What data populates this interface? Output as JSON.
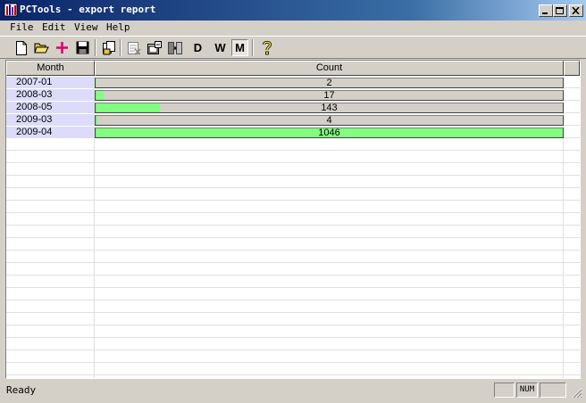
{
  "window": {
    "title": "PCTools - export report",
    "icons": {
      "app": "app-icon",
      "minimize": "minimize-icon",
      "maximize": "maximize-icon",
      "close": "close-icon"
    }
  },
  "menu": [
    "File",
    "Edit",
    "View",
    "Help"
  ],
  "toolbar": {
    "buttons": [
      "new-icon",
      "open-icon",
      "add-icon",
      "save-icon",
      "copy-icon",
      "filter-icon",
      "properties-icon",
      "columns-icon",
      "day-icon",
      "week-icon",
      "month-icon",
      "help-icon"
    ],
    "day_label": "D",
    "week_label": "W",
    "month_label": "M",
    "selected": "M"
  },
  "table": {
    "columns": [
      "Month",
      "Count"
    ],
    "max_count": 1046,
    "rows": [
      {
        "month": "2007-01",
        "count": 2
      },
      {
        "month": "2008-03",
        "count": 17
      },
      {
        "month": "2008-05",
        "count": 143
      },
      {
        "month": "2009-03",
        "count": 4
      },
      {
        "month": "2009-04",
        "count": 1046
      }
    ],
    "bar_color": "#80ff80",
    "month_cell_color": "#dcdcfa"
  },
  "status": {
    "text": "Ready",
    "num_indicator": "NUM"
  }
}
